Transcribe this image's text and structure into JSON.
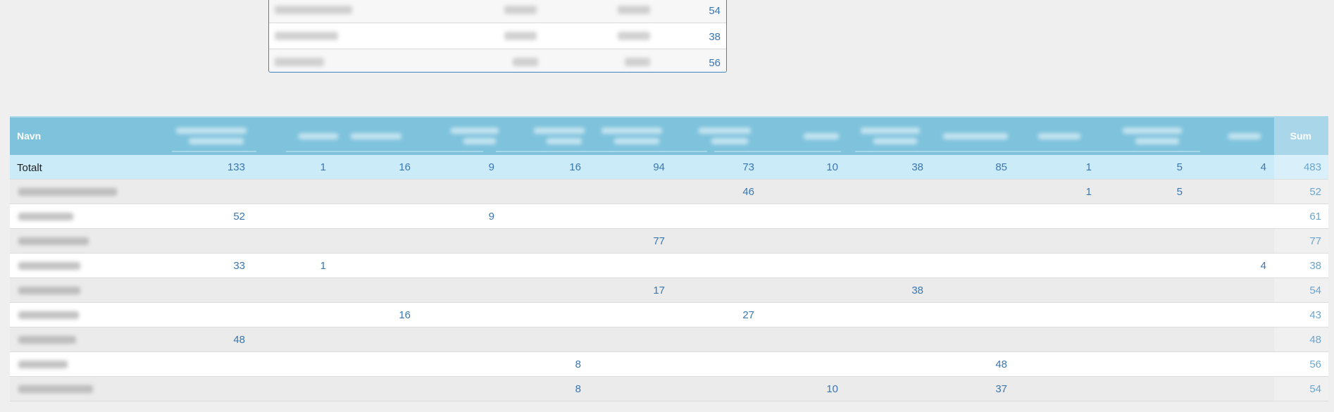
{
  "top_table": {
    "rows": [
      {
        "value": "54"
      },
      {
        "value": "38"
      },
      {
        "value": "56"
      }
    ]
  },
  "main_table": {
    "header": {
      "name": "Navn",
      "sum": "Sum"
    },
    "total": {
      "name": "Totalt",
      "cells": [
        "133",
        "1",
        "16",
        "9",
        "16",
        "94",
        "73",
        "10",
        "38",
        "85",
        "1",
        "5",
        "4"
      ],
      "sum": "483"
    },
    "rows": [
      {
        "cells": [
          "",
          "",
          "",
          "",
          "",
          "",
          "46",
          "",
          "",
          "",
          "1",
          "5",
          ""
        ],
        "sum": "52"
      },
      {
        "cells": [
          "52",
          "",
          "",
          "9",
          "",
          "",
          "",
          "",
          "",
          "",
          "",
          "",
          ""
        ],
        "sum": "61"
      },
      {
        "cells": [
          "",
          "",
          "",
          "",
          "",
          "77",
          "",
          "",
          "",
          "",
          "",
          "",
          ""
        ],
        "sum": "77"
      },
      {
        "cells": [
          "33",
          "1",
          "",
          "",
          "",
          "",
          "",
          "",
          "",
          "",
          "",
          "",
          "4"
        ],
        "sum": "38"
      },
      {
        "cells": [
          "",
          "",
          "",
          "",
          "",
          "17",
          "",
          "",
          "38",
          "",
          "",
          "",
          ""
        ],
        "sum": "54"
      },
      {
        "cells": [
          "",
          "",
          "16",
          "",
          "",
          "",
          "27",
          "",
          "",
          "",
          "",
          "",
          ""
        ],
        "sum": "43"
      },
      {
        "cells": [
          "48",
          "",
          "",
          "",
          "",
          "",
          "",
          "",
          "",
          "",
          "",
          "",
          ""
        ],
        "sum": "48"
      },
      {
        "cells": [
          "",
          "",
          "",
          "",
          "8",
          "",
          "",
          "",
          "",
          "48",
          "",
          "",
          ""
        ],
        "sum": "56"
      },
      {
        "cells": [
          "",
          "",
          "",
          "",
          "8",
          "",
          "",
          "10",
          "",
          "37",
          "",
          "",
          ""
        ],
        "sum": "54"
      }
    ]
  },
  "colors": {
    "header_bg": "#7ec2dc",
    "total_bg": "#ccebf8",
    "link_blue": "#3a77b0"
  }
}
